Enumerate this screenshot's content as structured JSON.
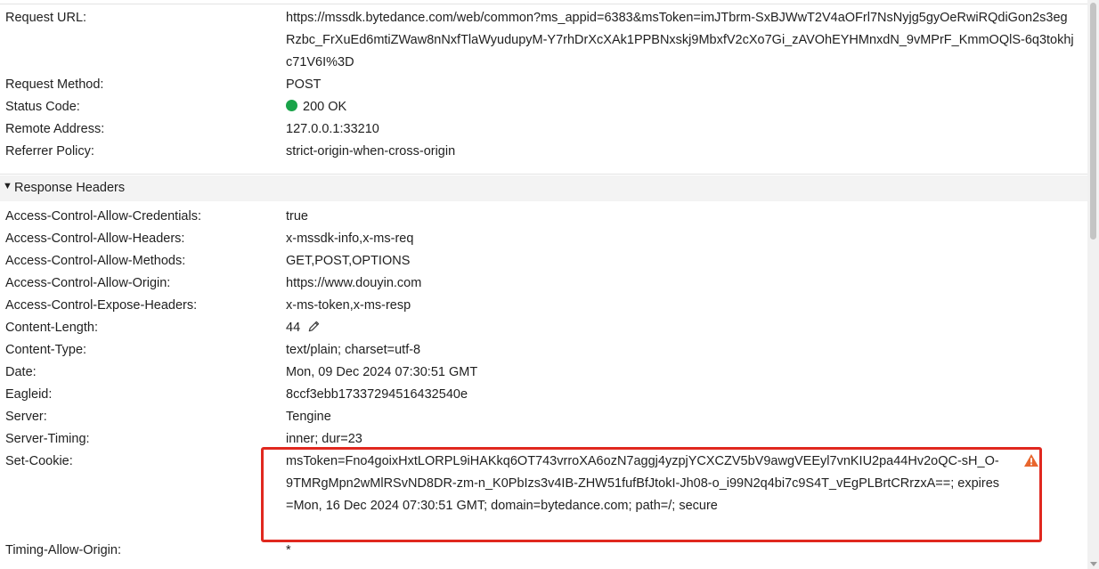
{
  "general": {
    "request_url": {
      "key": "Request URL:",
      "value": "https://mssdk.bytedance.com/web/common?ms_appid=6383&msToken=imJTbrm-SxBJWwT2V4aOFrl7NsNyjg5gyOeRwiRQdiGon2s3egRzbc_FrXuEd6mtiZWaw8nNxfTlaWyudupyM-Y7rhDrXcXAk1PPBNxskj9MbxfV2cXo7Gi_zAVOhEYHMnxdN_9vMPrF_KmmOQlS-6q3tokhjc71V6I%3D"
    },
    "request_method": {
      "key": "Request Method:",
      "value": "POST"
    },
    "status_code": {
      "key": "Status Code:",
      "value": "200 OK",
      "status_color": "#1aa349"
    },
    "remote_address": {
      "key": "Remote Address:",
      "value": "127.0.0.1:33210"
    },
    "referrer_policy": {
      "key": "Referrer Policy:",
      "value": "strict-origin-when-cross-origin"
    }
  },
  "response_headers": {
    "title": "Response Headers",
    "rows": [
      {
        "key": "Access-Control-Allow-Credentials:",
        "value": "true"
      },
      {
        "key": "Access-Control-Allow-Headers:",
        "value": "x-mssdk-info,x-ms-req"
      },
      {
        "key": "Access-Control-Allow-Methods:",
        "value": "GET,POST,OPTIONS"
      },
      {
        "key": "Access-Control-Allow-Origin:",
        "value": "https://www.douyin.com"
      },
      {
        "key": "Access-Control-Expose-Headers:",
        "value": "x-ms-token,x-ms-resp"
      },
      {
        "key": "Content-Length:",
        "value": "44"
      },
      {
        "key": "Content-Type:",
        "value": "text/plain; charset=utf-8"
      },
      {
        "key": "Date:",
        "value": "Mon, 09 Dec 2024 07:30:51 GMT"
      },
      {
        "key": "Eagleid:",
        "value": "8ccf3ebb17337294516432540e"
      },
      {
        "key": "Server:",
        "value": "Tengine"
      },
      {
        "key": "Server-Timing:",
        "value": "inner; dur=23"
      }
    ],
    "set_cookie": {
      "key": "Set-Cookie:",
      "value": "msToken=Fno4goixHxtLORPL9iHAKkq6OT743vrroXA6ozN7aggj4yzpjYCXCZV5bV9awgVEEyl7vnKIU2pa44Hv2oQC-sH_O-9TMRgMpn2wMlRSvND8DR-zm-n_K0PbIzs3v4IB-ZHW51fufBfJtokI-Jh08-o_i99N2q4bi7c9S4T_vEgPLBrtCRrzxA==; expires=Mon, 16 Dec 2024 07:30:51 GMT; domain=bytedance.com; path=/; secure"
    },
    "timing_allow_origin": {
      "key": "Timing-Allow-Origin:",
      "value": "*"
    }
  },
  "colors": {
    "highlight_border": "#e0281f",
    "warning": "#e8662e"
  },
  "icons": {
    "section_toggle": "triangle-down-icon",
    "edit": "pencil-icon",
    "warning": "warning-triangle-icon"
  }
}
